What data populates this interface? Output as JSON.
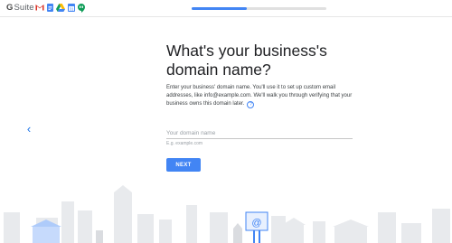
{
  "header": {
    "brand_g": "G",
    "brand_suite": "Suite",
    "app_icons": [
      "gmail-icon",
      "docs-icon",
      "drive-icon",
      "calendar-icon",
      "hangouts-icon"
    ],
    "progress": 0.41
  },
  "main": {
    "title": "What's your business's domain name?",
    "description": "Enter your business' domain name. You'll use it to set up custom email addresses, like info@example.com. We'll walk you through verifying that your business owns this domain later.",
    "help_glyph": "?",
    "domain_placeholder": "Your domain name",
    "domain_value": "",
    "hint": "E.g. example.com",
    "next_label": "NEXT",
    "back_glyph": "‹"
  },
  "illustration": {
    "sign_glyph": "@"
  },
  "colors": {
    "accent": "#4285f4",
    "city": "#e8eaed",
    "city_dark": "#dadce0"
  }
}
